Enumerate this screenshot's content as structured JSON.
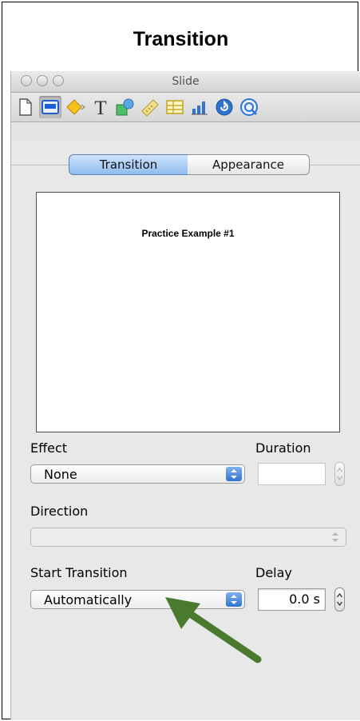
{
  "heading": "Transition",
  "window": {
    "title": "Slide"
  },
  "toolbar": {
    "icons": [
      {
        "name": "document-inspector-icon"
      },
      {
        "name": "slide-inspector-icon",
        "selected": true
      },
      {
        "name": "build-inspector-icon"
      },
      {
        "name": "text-inspector-icon"
      },
      {
        "name": "graphic-inspector-icon"
      },
      {
        "name": "metrics-inspector-icon"
      },
      {
        "name": "table-inspector-icon"
      },
      {
        "name": "chart-inspector-icon"
      },
      {
        "name": "hyperlink-inspector-icon"
      },
      {
        "name": "quicktime-inspector-icon"
      }
    ]
  },
  "tabs": {
    "transition": "Transition",
    "appearance": "Appearance",
    "selected": "Transition"
  },
  "preview": {
    "slide_title": "Practice Example #1"
  },
  "effect": {
    "label": "Effect",
    "value": "None"
  },
  "duration": {
    "label": "Duration",
    "value": ""
  },
  "direction": {
    "label": "Direction",
    "value": ""
  },
  "start_transition": {
    "label": "Start Transition",
    "value": "Automatically"
  },
  "delay": {
    "label": "Delay",
    "value": "0.0 s"
  },
  "colors": {
    "accent": "#2f74d0",
    "arrow": "#4a7a2e"
  }
}
